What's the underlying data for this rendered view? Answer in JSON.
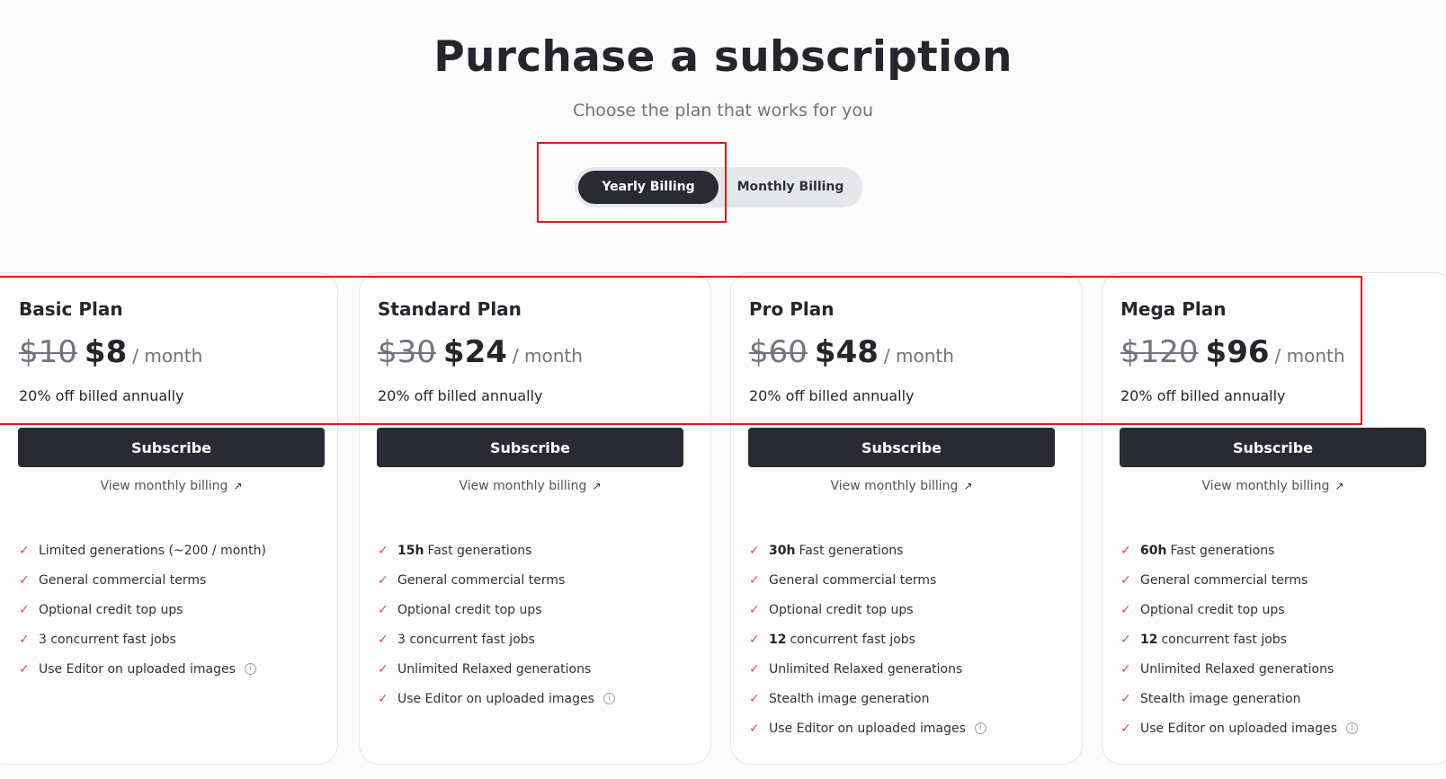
{
  "header": {
    "title": "Purchase a subscription",
    "subtitle": "Choose the plan that works for you"
  },
  "billing_toggle": {
    "yearly_label": "Yearly Billing",
    "monthly_label": "Monthly Billing",
    "selected": "Yearly Billing"
  },
  "plans": [
    {
      "name": "Basic Plan",
      "old_price": "$10",
      "price": "$8",
      "period": "/ month",
      "discount": "20% off billed annually",
      "subscribe_label": "Subscribe",
      "view_monthly_label": "View monthly billing",
      "features": [
        {
          "bold": "",
          "text": "Limited generations (~200 / month)"
        },
        {
          "bold": "",
          "text": "General commercial terms"
        },
        {
          "bold": "",
          "text": "Optional credit top ups"
        },
        {
          "bold": "",
          "text": "3 concurrent fast jobs"
        },
        {
          "bold": "",
          "text": "Use Editor on uploaded images",
          "info": true
        }
      ]
    },
    {
      "name": "Standard Plan",
      "old_price": "$30",
      "price": "$24",
      "period": "/ month",
      "discount": "20% off billed annually",
      "subscribe_label": "Subscribe",
      "view_monthly_label": "View monthly billing",
      "features": [
        {
          "bold": "15h",
          "text": "Fast generations"
        },
        {
          "bold": "",
          "text": "General commercial terms"
        },
        {
          "bold": "",
          "text": "Optional credit top ups"
        },
        {
          "bold": "",
          "text": "3 concurrent fast jobs"
        },
        {
          "bold": "",
          "text": "Unlimited Relaxed generations"
        },
        {
          "bold": "",
          "text": "Use Editor on uploaded images",
          "info": true
        }
      ]
    },
    {
      "name": "Pro Plan",
      "old_price": "$60",
      "price": "$48",
      "period": "/ month",
      "discount": "20% off billed annually",
      "subscribe_label": "Subscribe",
      "view_monthly_label": "View monthly billing",
      "features": [
        {
          "bold": "30h",
          "text": "Fast generations"
        },
        {
          "bold": "",
          "text": "General commercial terms"
        },
        {
          "bold": "",
          "text": "Optional credit top ups"
        },
        {
          "bold": "12",
          "text": "concurrent fast jobs"
        },
        {
          "bold": "",
          "text": "Unlimited Relaxed generations"
        },
        {
          "bold": "",
          "text": "Stealth image generation"
        },
        {
          "bold": "",
          "text": "Use Editor on uploaded images",
          "info": true
        }
      ]
    },
    {
      "name": "Mega Plan",
      "old_price": "$120",
      "price": "$96",
      "period": "/ month",
      "discount": "20% off billed annually",
      "subscribe_label": "Subscribe",
      "view_monthly_label": "View monthly billing",
      "features": [
        {
          "bold": "60h",
          "text": "Fast generations"
        },
        {
          "bold": "",
          "text": "General commercial terms"
        },
        {
          "bold": "",
          "text": "Optional credit top ups"
        },
        {
          "bold": "12",
          "text": "concurrent fast jobs"
        },
        {
          "bold": "",
          "text": "Unlimited Relaxed generations"
        },
        {
          "bold": "",
          "text": "Stealth image generation"
        },
        {
          "bold": "",
          "text": "Use Editor on uploaded images",
          "info": true
        }
      ]
    }
  ],
  "icons": {
    "check": "check-icon",
    "arrow": "arrow-up-right-icon",
    "info": "info-icon"
  },
  "colors": {
    "primary": "#2a2b32",
    "check": "#e5484d",
    "highlight": "#e8141c",
    "background": "#fbfbfb"
  }
}
